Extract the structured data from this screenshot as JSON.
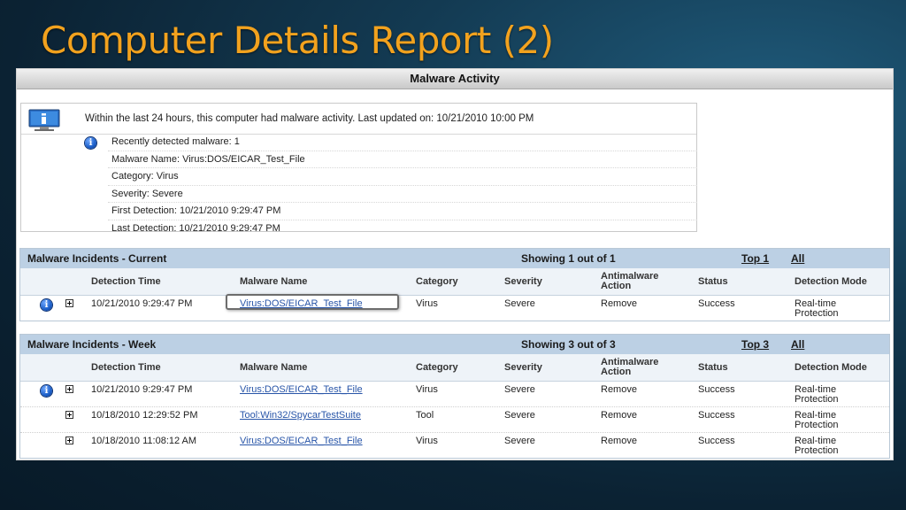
{
  "slide": {
    "title": "Computer Details Report (2)"
  },
  "activity": {
    "header": "Malware Activity",
    "summary": "Within the last 24 hours, this computer had malware activity. Last updated on: 10/21/2010 10:00 PM",
    "details": [
      "Recently detected malware: 1",
      "Malware Name: Virus:DOS/EICAR_Test_File",
      "Category: Virus",
      "Severity: Severe",
      "First Detection: 10/21/2010 9:29:47 PM",
      "Last Detection: 10/21/2010 9:29:47 PM"
    ]
  },
  "columns": {
    "detection_time": "Detection Time",
    "malware_name": "Malware Name",
    "category": "Category",
    "severity": "Severity",
    "action": "Antimalware Action",
    "status": "Status",
    "mode": "Detection Mode"
  },
  "current": {
    "title": "Malware Incidents - Current",
    "showing": "Showing 1 out of 1",
    "top": "Top 1",
    "all": "All",
    "rows": [
      {
        "time": "10/21/2010 9:29:47 PM",
        "name": "Virus:DOS/EICAR_Test_File",
        "category": "Virus",
        "severity": "Severe",
        "action": "Remove",
        "status": "Success",
        "mode": "Real-time Protection"
      }
    ]
  },
  "week": {
    "title": "Malware Incidents - Week",
    "showing": "Showing 3 out of 3",
    "top": "Top 3",
    "all": "All",
    "rows": [
      {
        "time": "10/21/2010 9:29:47 PM",
        "name": "Virus:DOS/EICAR_Test_File",
        "category": "Virus",
        "severity": "Severe",
        "action": "Remove",
        "status": "Success",
        "mode": "Real-time Protection"
      },
      {
        "time": "10/18/2010 12:29:52 PM",
        "name": "Tool:Win32/SpycarTestSuite",
        "category": "Tool",
        "severity": "Severe",
        "action": "Remove",
        "status": "Success",
        "mode": "Real-time Protection"
      },
      {
        "time": "10/18/2010 11:08:12 AM",
        "name": "Virus:DOS/EICAR_Test_File",
        "category": "Virus",
        "severity": "Severe",
        "action": "Remove",
        "status": "Success",
        "mode": "Real-time Protection"
      }
    ]
  },
  "icons": {
    "info": "info-icon",
    "expand": "expand-plus-icon",
    "computer": "computer-monitor-icon"
  },
  "colors": {
    "title": "#f2a21e",
    "section_header": "#bcd0e4",
    "link": "#2855a8"
  }
}
